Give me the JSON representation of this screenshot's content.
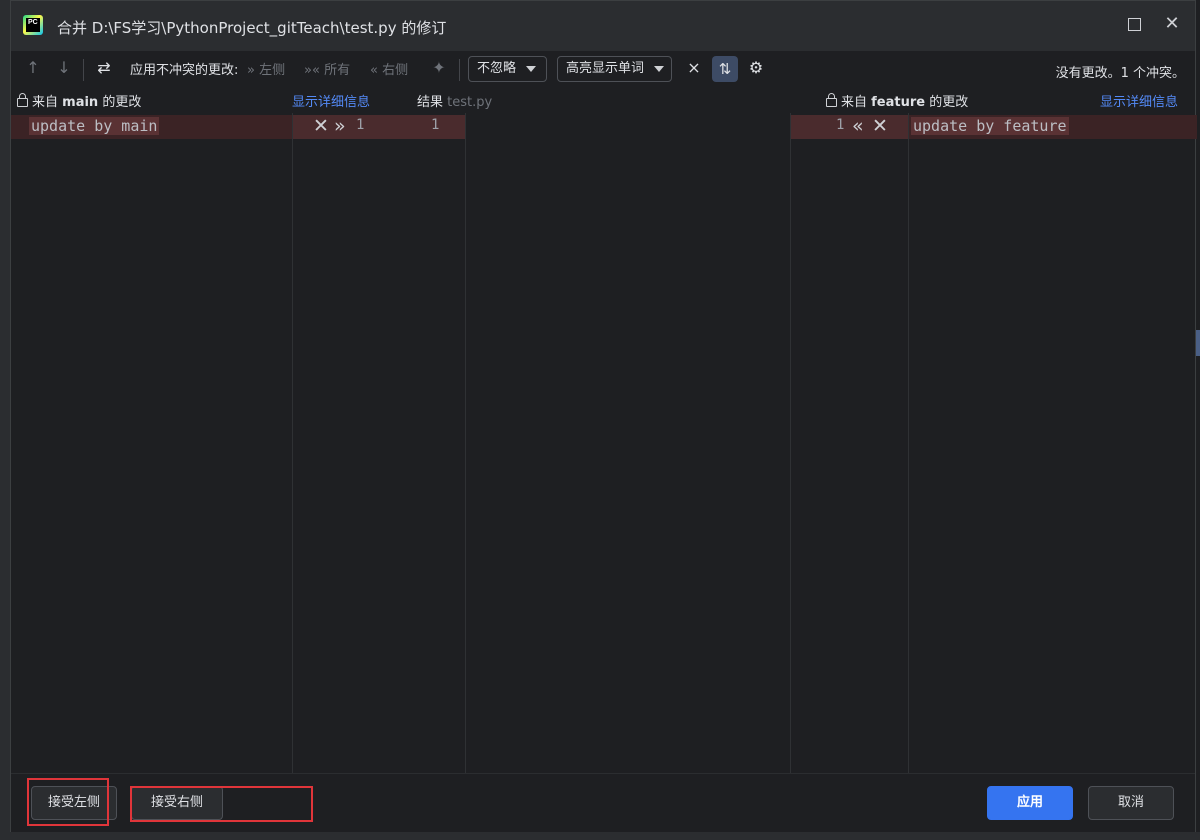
{
  "window": {
    "title": "合并 D:\\FS学习\\PythonProject_gitTeach\\test.py 的修订",
    "logo_text": "PC"
  },
  "toolbar": {
    "apply_non_conflicting_label": "应用不冲突的更改:",
    "left_label": "左侧",
    "all_label": "所有",
    "right_label": "右侧",
    "ignore_dropdown": "不忽略",
    "highlight_dropdown": "高亮显示单词",
    "status": "没有更改。1 个冲突。"
  },
  "headers": {
    "left_prefix": "来自",
    "left_branch": "main",
    "left_suffix": "的更改",
    "left_link": "显示详细信息",
    "result_label": "结果",
    "result_file": "test.py",
    "right_prefix": "来自",
    "right_branch": "feature",
    "right_suffix": "的更改",
    "right_link": "显示详细信息"
  },
  "editor": {
    "left_line": "update by main",
    "right_line": "update by feature",
    "left_gutter_line_number": "1",
    "result_line_number": "1",
    "right_gutter_line_number": "1"
  },
  "footer": {
    "accept_left": "接受左侧",
    "accept_right": "接受右侧",
    "apply": "应用",
    "cancel": "取消"
  },
  "colors": {
    "background": "#1e1f22",
    "panel": "#2b2d30",
    "conflict": "#3b2325",
    "link": "#548af7",
    "primary_button": "#3574f0",
    "annotation_box": "#e0353a"
  }
}
